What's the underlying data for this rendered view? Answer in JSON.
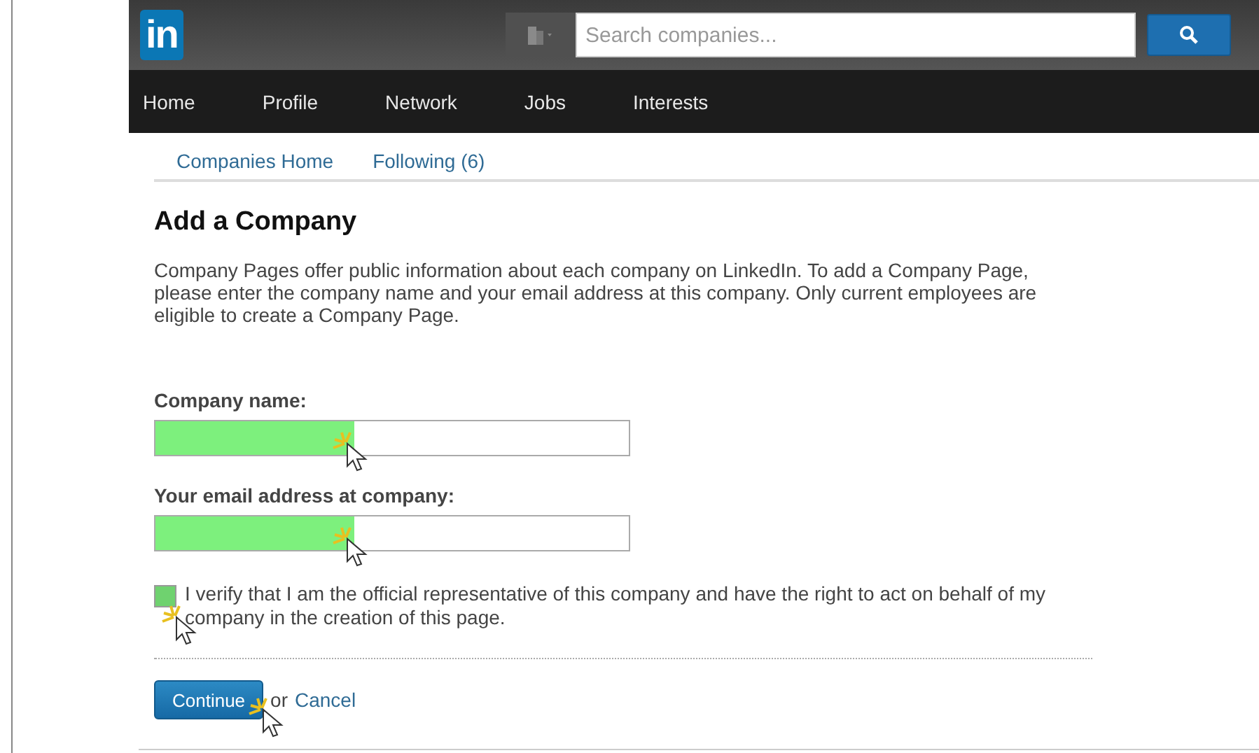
{
  "header": {
    "logo": "in",
    "search": {
      "placeholder": "Search companies..."
    }
  },
  "nav": [
    {
      "label": "Home"
    },
    {
      "label": "Profile"
    },
    {
      "label": "Network"
    },
    {
      "label": "Jobs"
    },
    {
      "label": "Interests"
    }
  ],
  "subnav": [
    {
      "label": "Companies Home"
    },
    {
      "label": "Following (6)"
    }
  ],
  "page": {
    "title": "Add a Company",
    "intro": "Company Pages offer public information about each company on LinkedIn. To add a Company Page, please enter the company name and your email address at this company. Only current employees are eligible to create a Company Page."
  },
  "fields": [
    {
      "label": "Company name:",
      "highlighted": true
    },
    {
      "label": "Your email address at company:",
      "highlighted": true
    }
  ],
  "verify": {
    "text": "I verify that I am the official representative of this company and have the right to act on behalf of my company in the creation of this page.",
    "checked": false,
    "highlighted": true
  },
  "actions": {
    "primary": "Continue",
    "separator": "or",
    "cancel": "Cancel"
  }
}
